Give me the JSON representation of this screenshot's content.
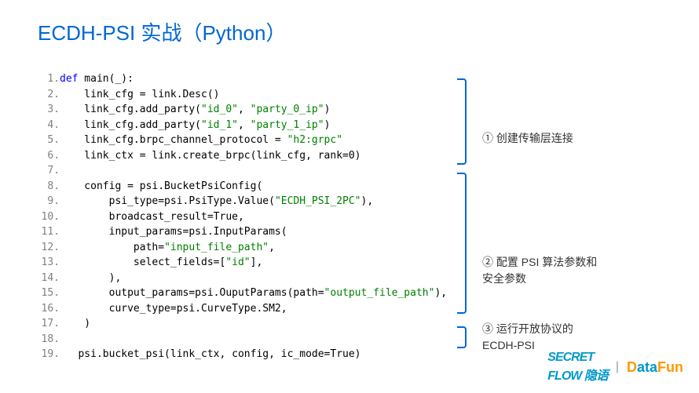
{
  "title": "ECDH-PSI 实战（Python）",
  "code": {
    "lines": [
      {
        "n": "1.",
        "t": [
          "def",
          " main(_):"
        ]
      },
      {
        "n": "2.",
        "t": [
          "    link_cfg = link.Desc()"
        ]
      },
      {
        "n": "3.",
        "t": [
          "    link_cfg.add_party(",
          "\"id_0\"",
          ", ",
          "\"party_0_ip\"",
          ")"
        ]
      },
      {
        "n": "4.",
        "t": [
          "    link_cfg.add_party(",
          "\"id_1\"",
          ", ",
          "\"party_1_ip\"",
          ")"
        ]
      },
      {
        "n": "5.",
        "t": [
          "    link_cfg.brpc_channel_protocol = ",
          "\"h2:grpc\""
        ]
      },
      {
        "n": "6.",
        "t": [
          "    link_ctx = link.create_brpc(link_cfg, rank=0)"
        ]
      },
      {
        "n": "7.",
        "t": [
          ""
        ]
      },
      {
        "n": "8.",
        "t": [
          "    config = psi.BucketPsiConfig("
        ]
      },
      {
        "n": "9.",
        "t": [
          "        psi_type=psi.PsiType.Value(",
          "\"ECDH_PSI_2PC\"",
          "),"
        ]
      },
      {
        "n": "10.",
        "t": [
          "        broadcast_result=True,"
        ]
      },
      {
        "n": "11.",
        "t": [
          "        input_params=psi.InputParams("
        ]
      },
      {
        "n": "12.",
        "t": [
          "            path=",
          "\"input_file_path\"",
          ","
        ]
      },
      {
        "n": "13.",
        "t": [
          "            select_fields=[",
          "\"id\"",
          "],"
        ]
      },
      {
        "n": "14.",
        "t": [
          "        ),"
        ]
      },
      {
        "n": "15.",
        "t": [
          "        output_params=psi.OuputParams(path=",
          "\"output_file_path\"",
          "),"
        ]
      },
      {
        "n": "16.",
        "t": [
          "        curve_type=psi.CurveType.SM2,"
        ]
      },
      {
        "n": "17.",
        "t": [
          "    )"
        ]
      },
      {
        "n": "18.",
        "t": [
          ""
        ]
      },
      {
        "n": "19.",
        "t": [
          "   psi.bucket_psi(link_ctx, config, ic_mode=True)"
        ]
      }
    ]
  },
  "annotations": {
    "a1": "① 创建传输层连接",
    "a2": "② 配置 PSI 算法参数和\n      安全参数",
    "a3": "③ 运行开放协议的\n      ECDH-PSI"
  },
  "footer": {
    "logo1_main": "SECRET",
    "logo1_sub": "FLOW 隐语",
    "sep": "|",
    "logo2": "DataFun"
  }
}
